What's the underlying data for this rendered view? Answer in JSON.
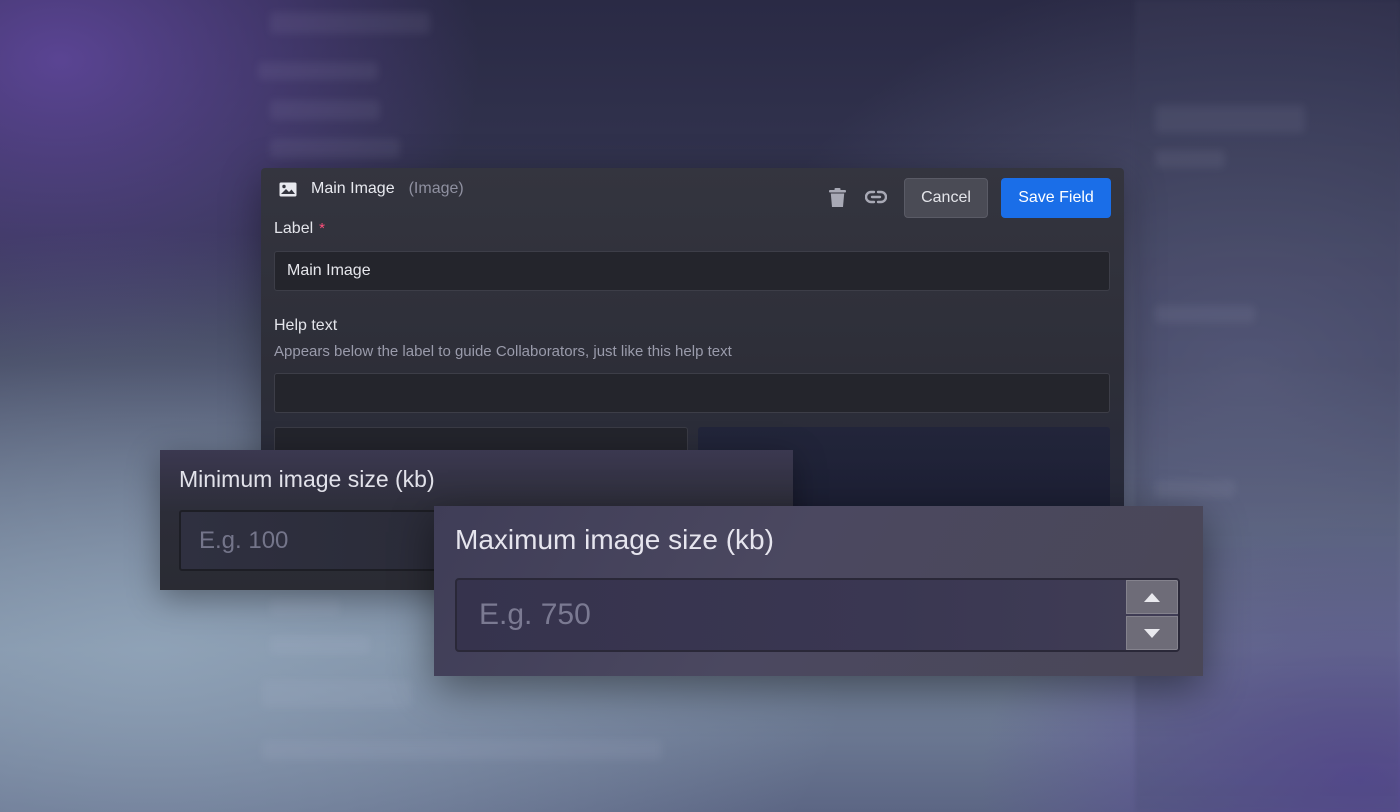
{
  "modal": {
    "title": "Main Image",
    "type_hint": "(Image)",
    "icon": "image-icon",
    "actions": {
      "delete_icon": "trash-icon",
      "link_icon": "link-icon",
      "cancel_label": "Cancel",
      "save_label": "Save Field"
    },
    "label_field": {
      "label": "Label",
      "required_mark": "*",
      "value": "Main Image"
    },
    "help_field": {
      "label": "Help text",
      "description": "Appears below the label to guide Collaborators, just like this help text",
      "value": ""
    }
  },
  "min_size": {
    "label": "Minimum image size (kb)",
    "placeholder": "E.g. 100"
  },
  "max_size": {
    "label": "Maximum image size (kb)",
    "placeholder": "E.g. 750",
    "increment_icon": "caret-up-icon",
    "decrement_icon": "caret-down-icon"
  },
  "colors": {
    "accent": "#1a6ee8",
    "required": "#ff4f7b"
  }
}
